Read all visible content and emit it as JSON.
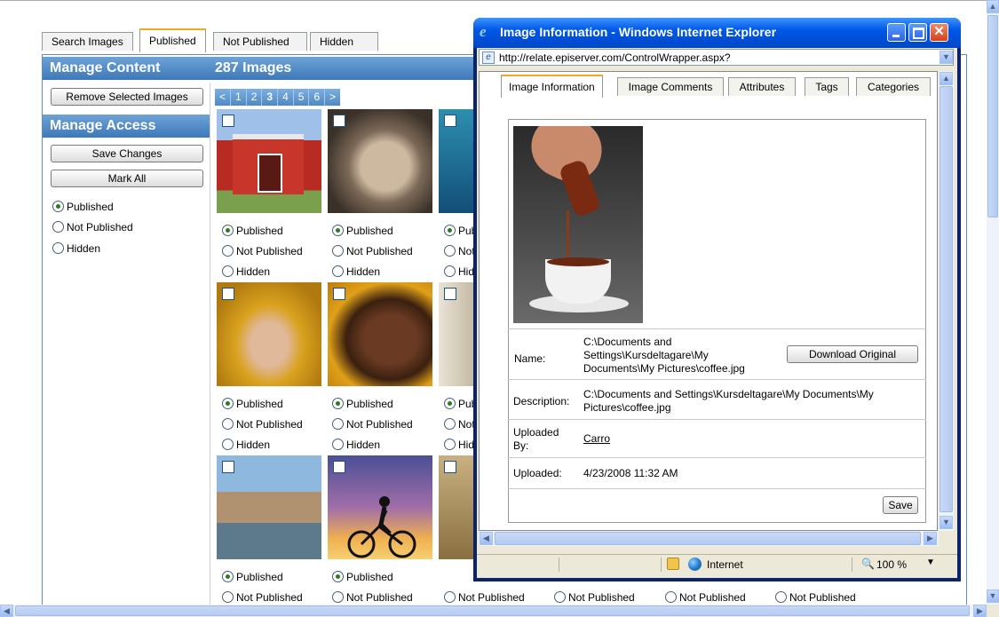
{
  "main": {
    "tabs": [
      "Search Images",
      "Published",
      "Not Published",
      "Hidden"
    ],
    "manage_content_title": "Manage Content",
    "images_count": "287 Images",
    "remove_button": "Remove Selected Images",
    "manage_access_title": "Manage Access",
    "save_changes_button": "Save Changes",
    "mark_all_button": "Mark All",
    "access_options": [
      "Published",
      "Not Published",
      "Hidden"
    ],
    "pager": [
      "<",
      "1",
      "2",
      "3",
      "4",
      "5",
      "6",
      ">"
    ],
    "current_page": "3",
    "status_options": [
      "Published",
      "Not Published",
      "Hidden"
    ]
  },
  "popup": {
    "title": "Image Information - Windows Internet Explorer",
    "url": "http://relate.episerver.com/ControlWrapper.aspx?",
    "tabs": [
      "Image Information",
      "Image Comments",
      "Attributes",
      "Tags",
      "Categories"
    ],
    "name_label": "Name:",
    "name_value_1": "C:\\Documents and",
    "name_value_2": "Settings\\Kursdeltagare\\My",
    "name_value_3": "Documents\\My Pictures\\coffee.jpg",
    "download_button": "Download Original",
    "description_label": "Description:",
    "description_value_1": "C:\\Documents and Settings\\Kursdeltagare\\My Documents\\My",
    "description_value_2": "Pictures\\coffee.jpg",
    "uploaded_by_label_1": "Uploaded",
    "uploaded_by_label_2": "By:",
    "uploaded_by_value": "Carro",
    "uploaded_label": "Uploaded:",
    "uploaded_value": "4/23/2008 11:32 AM",
    "save_button": "Save",
    "status_zone": "Internet",
    "zoom": "100 %"
  }
}
